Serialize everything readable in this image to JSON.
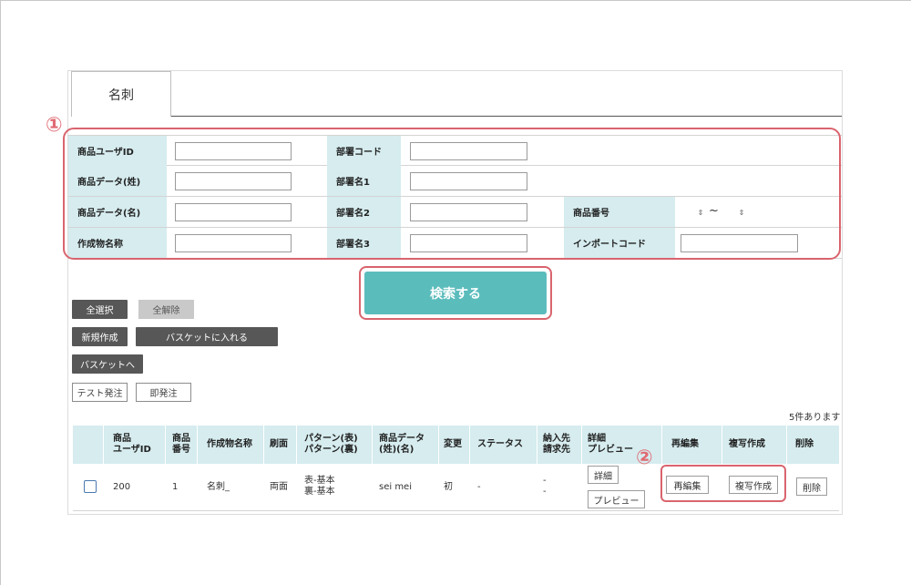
{
  "tabs": [
    {
      "label": "名刺"
    }
  ],
  "annotations": {
    "one": "①",
    "two": "②"
  },
  "search_form": {
    "product_user_id": {
      "label": "商品ユーザID",
      "value": ""
    },
    "product_data_last": {
      "label": "商品データ(姓)",
      "value": ""
    },
    "product_data_first": {
      "label": "商品データ(名)",
      "value": ""
    },
    "artifact_name": {
      "label": "作成物名称",
      "value": ""
    },
    "dept_code": {
      "label": "部署コード",
      "value": ""
    },
    "dept_name1": {
      "label": "部署名1",
      "value": ""
    },
    "dept_name2": {
      "label": "部署名2",
      "value": ""
    },
    "dept_name3": {
      "label": "部署名3",
      "value": ""
    },
    "product_number": {
      "label": "商品番号",
      "range_separator": "~"
    },
    "import_code": {
      "label": "インポートコード",
      "value": ""
    }
  },
  "search_button": "検索する",
  "actions": {
    "select_all": "全選択",
    "deselect_all": "全解除",
    "new_create": "新規作成",
    "add_to_basket": "バスケットに入れる",
    "to_basket": "バスケットへ",
    "test_order": "テスト発注",
    "instant_order": "即発注"
  },
  "result_count": "5件あります",
  "table": {
    "headers": {
      "user_id": [
        "商品",
        "ユーザID"
      ],
      "number": [
        "商品",
        "番号"
      ],
      "name": "作成物名称",
      "print_side": "刷面",
      "pattern": [
        "パターン(表)",
        "パターン(裏)"
      ],
      "data": [
        "商品データ",
        "(姓)(名)"
      ],
      "change": "変更",
      "status": "ステータス",
      "delivery": [
        "納入先",
        "請求先"
      ],
      "detail": [
        "詳細",
        "プレビュー"
      ],
      "reedit": "再編集",
      "copy": "複写作成",
      "delete": "削除"
    },
    "rows": [
      {
        "user_id": "200",
        "number": "1",
        "name": "名刺_",
        "print_side": "両面",
        "pattern": [
          "表-基本",
          "裏-基本"
        ],
        "data": "sei mei",
        "change": "初",
        "status": "-",
        "delivery": [
          "-",
          "-"
        ],
        "detail_btn": "詳細",
        "preview_btn": "プレビュー",
        "reedit_btn": "再編集",
        "copy_btn": "複写作成",
        "delete_btn": "削除"
      }
    ]
  }
}
